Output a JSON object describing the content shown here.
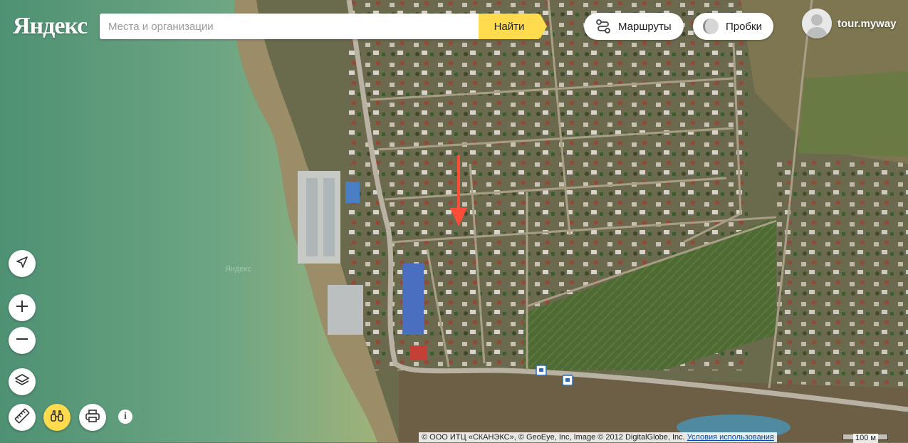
{
  "header": {
    "logo": "Яндекс",
    "search_placeholder": "Места и организации",
    "search_button": "Найти",
    "routes_label": "Маршруты",
    "traffic_label": "Пробки",
    "username": "tour.myway"
  },
  "map": {
    "type": "satellite",
    "watermark": "Яндекс",
    "marker": "red-arrow-icon"
  },
  "controls": {
    "geolocation": "geolocation-icon",
    "zoom_in": "plus-icon",
    "zoom_out": "minus-icon",
    "layers": "layers-icon",
    "ruler": "ruler-icon",
    "panorama": "binoculars-icon",
    "print": "printer-icon",
    "info": "i"
  },
  "footer": {
    "copyright": "© ООО ИТЦ «СКАНЭКС», © GeoEye, Inc, Image © 2012 DigitalGlobe, Inc.",
    "terms_link": "Условия использования",
    "scale_label": "100 м"
  },
  "colors": {
    "accent": "#ffdb4d",
    "sea": "#5f9b7c",
    "marker": "#ff4d3a"
  }
}
